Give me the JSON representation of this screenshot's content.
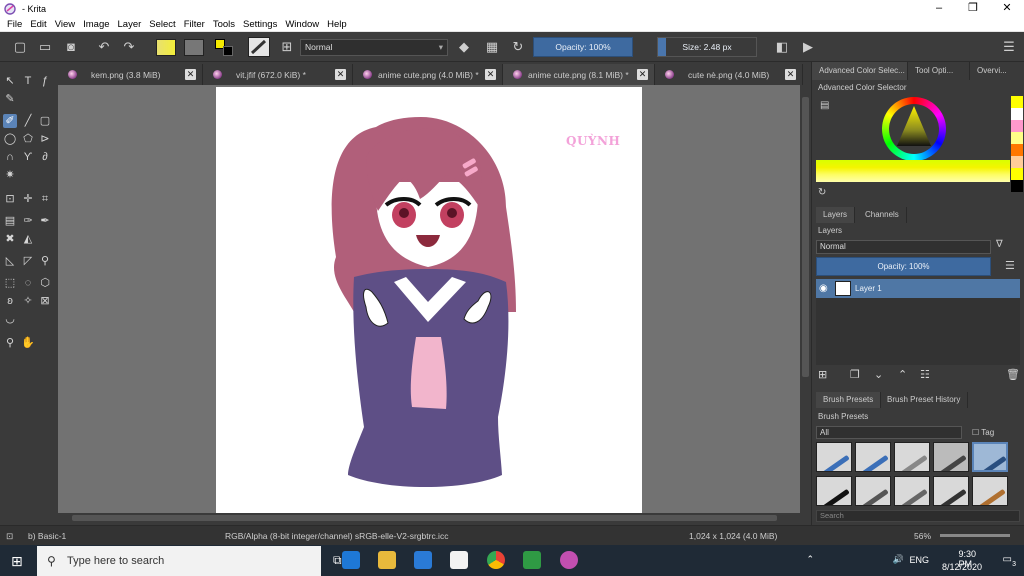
{
  "window": {
    "title": "- Krita",
    "minimize": "–",
    "maximize": "❐",
    "close": "✕"
  },
  "menu": [
    "File",
    "Edit",
    "View",
    "Image",
    "Layer",
    "Select",
    "Filter",
    "Tools",
    "Settings",
    "Window",
    "Help"
  ],
  "toolbar": {
    "blend_mode": "Normal",
    "opacity": "Opacity: 100%",
    "size": "Size: 2.48 px"
  },
  "tabs": [
    {
      "label": "kem.png (3.8 MiB)"
    },
    {
      "label": "vit.jfif (672.0 KiB) *"
    },
    {
      "label": "anime cute.png (4.0 MiB) *"
    },
    {
      "label": "anime cute.png (8.1 MiB) *"
    },
    {
      "label": "cute nè.png (4.0 MiB)"
    }
  ],
  "canvas": {
    "signature": "QUỲNH"
  },
  "dock": {
    "top_tabs": [
      "Advanced Color Selec...",
      "Tool Opti...",
      "Overvi..."
    ],
    "color_selector_title": "Advanced Color Selector",
    "layer_tabs": [
      "Layers",
      "Channels"
    ],
    "layers_title": "Layers",
    "layer_mode": "Normal",
    "layer_opacity": "Opacity:  100%",
    "layer_name": "Layer 1",
    "brush_tabs": [
      "Brush Presets",
      "Brush Preset History"
    ],
    "brush_title": "Brush Presets",
    "brush_filter": "All",
    "brush_tag": "Tag",
    "search_placeholder": "Search",
    "palette": [
      "#ffff00",
      "#ffffff",
      "#ff99cc",
      "#ffff88",
      "#ff7700",
      "#ffcc99",
      "#ffff00",
      "#000000"
    ]
  },
  "status": {
    "brush": "b) Basic-1",
    "color_profile": "RGB/Alpha (8-bit integer/channel)  sRGB-elle-V2-srgbtrc.icc",
    "dimensions": "1,024 x 1,024 (4.0 MiB)",
    "zoom": "56%"
  },
  "taskbar": {
    "search_placeholder": "Type here to search",
    "language": "ENG",
    "time": "9:30 PM",
    "date": "8/12/2020",
    "notifications": "3"
  }
}
